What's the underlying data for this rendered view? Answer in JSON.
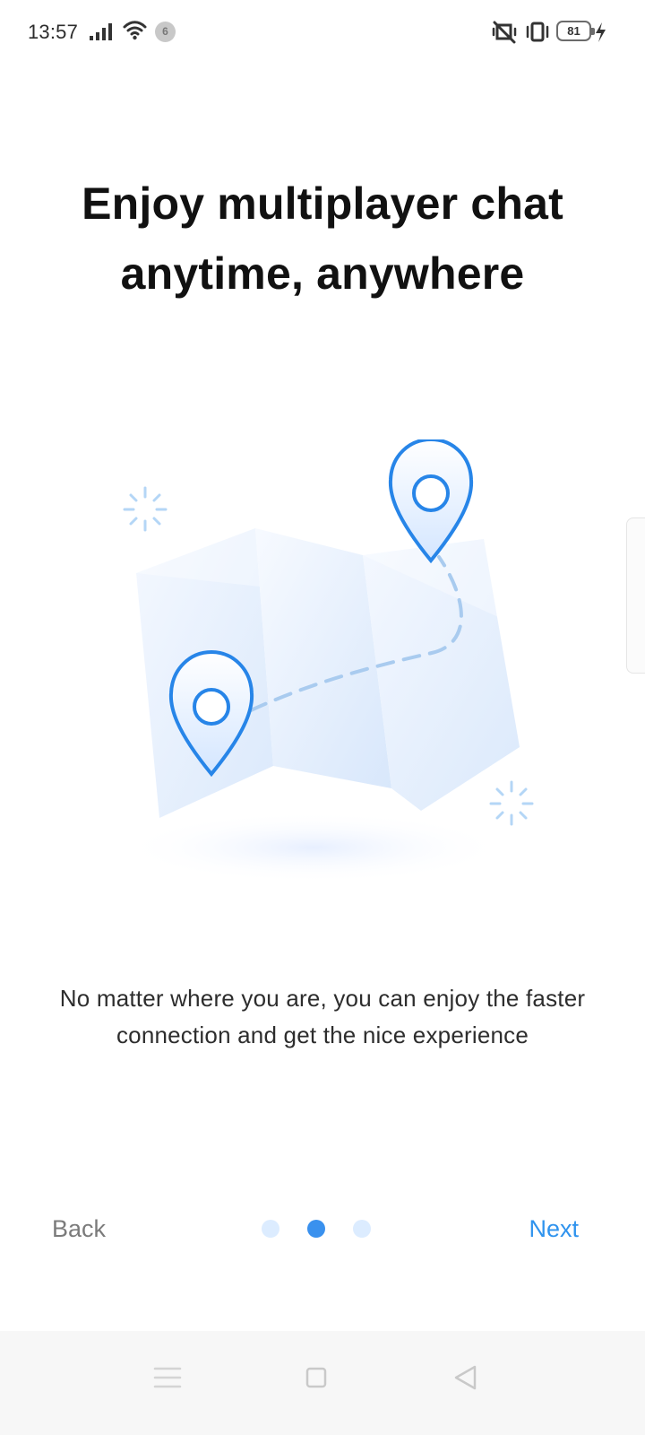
{
  "status_bar": {
    "time": "13:57",
    "notification_count": "6",
    "battery_level": "81",
    "icons": [
      "signal-icon",
      "wifi-icon",
      "vibrate-mute-icon",
      "vibration-icon",
      "charging-icon"
    ]
  },
  "onboarding": {
    "headline": "Enjoy multiplayer chat anytime, anywhere",
    "description": "No matter where you are, you can enjoy the faster connection and get the nice experience",
    "back_label": "Back",
    "next_label": "Next",
    "page_indicator": {
      "current_page": 2,
      "total_pages": 3
    }
  },
  "system_nav": {
    "icons": [
      "menu-icon",
      "home-square-icon",
      "back-triangle-icon"
    ]
  },
  "colors": {
    "accent": "#2f93ee",
    "active_dot": "#3a91ee",
    "inactive_dot": "#dcecff",
    "text_primary": "#111111",
    "text_secondary": "#2d2d2d",
    "muted_button": "#7b7b7b"
  }
}
